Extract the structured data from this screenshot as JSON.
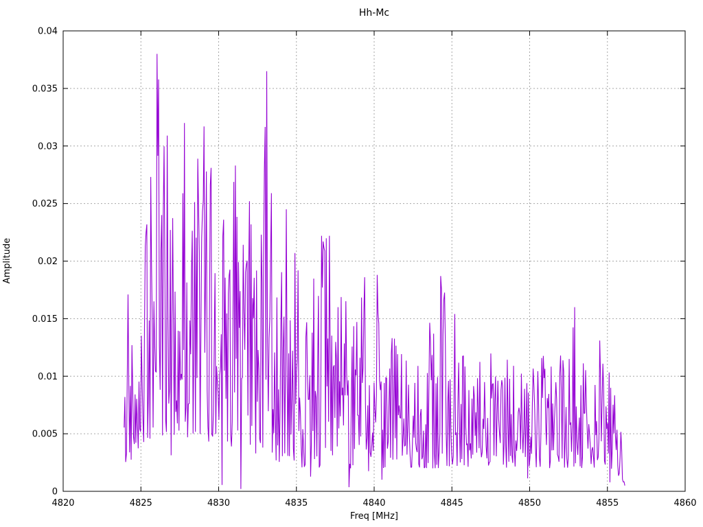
{
  "chart_data": {
    "type": "line",
    "title": "Hh-Mc",
    "xlabel": "Freq [MHz]",
    "ylabel": "Amplitude",
    "xlim": [
      4820,
      4860
    ],
    "ylim": [
      0,
      0.04
    ],
    "x_ticks": [
      4820,
      4825,
      4830,
      4835,
      4840,
      4845,
      4850,
      4855,
      4860
    ],
    "x_tick_labels": [
      "4820",
      "4825",
      "4830",
      "4835",
      "4840",
      "4845",
      "4850",
      "4855",
      "4860"
    ],
    "y_ticks": [
      0,
      0.005,
      0.01,
      0.015,
      0.02,
      0.025,
      0.03,
      0.035,
      0.04
    ],
    "y_tick_labels": [
      "0",
      "0.005",
      "0.01",
      "0.015",
      "0.02",
      "0.025",
      "0.03",
      "0.035",
      "0.04"
    ],
    "grid": true,
    "legend": "none",
    "line_color": "#9400d3",
    "grid_color": "#a6a6a6",
    "axis_color": "#000000",
    "background_color": "#ffffff",
    "data_start_freq": 4823.92,
    "data_end_freq": 4856.12,
    "n_points": 640,
    "noise_seed": 42,
    "envelope": {
      "freq": [
        4824.0,
        4824.5,
        4825.0,
        4825.5,
        4826.0,
        4826.5,
        4827.0,
        4827.5,
        4828.0,
        4828.5,
        4829.0,
        4829.5,
        4830.0,
        4830.5,
        4831.0,
        4831.5,
        4832.0,
        4832.5,
        4833.0,
        4833.5,
        4834.0,
        4834.5,
        4835.0,
        4835.5,
        4836.0,
        4836.5,
        4837.0,
        4837.5,
        4838.0,
        4838.5,
        4839.0,
        4839.5,
        4840.0,
        4840.5,
        4841.0,
        4841.5,
        4842.0,
        4842.5,
        4843.0,
        4843.5,
        4844.0,
        4844.5,
        4845.0,
        4845.5,
        4846.0,
        4846.5,
        4847.0,
        4847.5,
        4848.0,
        4848.5,
        4849.0,
        4849.5,
        4850.0,
        4850.5,
        4851.0,
        4851.5,
        4852.0,
        4852.5,
        4853.0,
        4853.5,
        4854.0,
        4854.5,
        4855.0,
        4855.5,
        4856.0
      ],
      "max": [
        0.01,
        0.017,
        0.019,
        0.027,
        0.038,
        0.031,
        0.027,
        0.029,
        0.032,
        0.029,
        0.032,
        0.028,
        0.024,
        0.024,
        0.028,
        0.022,
        0.025,
        0.022,
        0.0365,
        0.026,
        0.02,
        0.0245,
        0.02,
        0.019,
        0.021,
        0.0222,
        0.0222,
        0.02,
        0.016,
        0.019,
        0.018,
        0.0186,
        0.0188,
        0.018,
        0.014,
        0.0147,
        0.0135,
        0.0148,
        0.013,
        0.015,
        0.016,
        0.0187,
        0.0154,
        0.013,
        0.0132,
        0.012,
        0.0112,
        0.0125,
        0.011,
        0.0121,
        0.011,
        0.0123,
        0.0115,
        0.0108,
        0.0122,
        0.011,
        0.0135,
        0.013,
        0.016,
        0.012,
        0.011,
        0.0131,
        0.0108,
        0.009,
        0.0045
      ],
      "min": [
        0.002,
        0.003,
        0.004,
        0.004,
        0.005,
        0.004,
        0.003,
        0.004,
        0.003,
        0.004,
        0.005,
        0.004,
        0.003,
        0.004,
        0.003,
        0.002,
        0.003,
        0.003,
        0.004,
        0.003,
        0.002,
        0.003,
        0.002,
        0.002,
        0.003,
        0.002,
        0.003,
        0.002,
        0.002,
        0.002,
        0.003,
        0.002,
        0.001,
        0.002,
        0.002,
        0.002,
        0.002,
        0.002,
        0.002,
        0.002,
        0.002,
        0.002,
        0.002,
        0.002,
        0.002,
        0.002,
        0.0015,
        0.002,
        0.002,
        0.002,
        0.0015,
        0.002,
        0.002,
        0.002,
        0.002,
        0.002,
        0.002,
        0.002,
        0.002,
        0.002,
        0.002,
        0.002,
        0.002,
        0.0015,
        0.0008
      ]
    },
    "notable_points": [
      [
        4824.18,
        0.0171
      ],
      [
        4826.05,
        0.038
      ],
      [
        4826.7,
        0.0309
      ],
      [
        4827.78,
        0.032
      ],
      [
        4828.65,
        0.0289
      ],
      [
        4829.05,
        0.0317
      ],
      [
        4829.5,
        0.0281
      ],
      [
        4830.3,
        0.0236
      ],
      [
        4831.1,
        0.0283
      ],
      [
        4831.42,
        0.0002
      ],
      [
        4832.0,
        0.0252
      ],
      [
        4833.08,
        0.0365
      ],
      [
        4833.4,
        0.0259
      ],
      [
        4834.35,
        0.0245
      ],
      [
        4836.6,
        0.0222
      ],
      [
        4837.1,
        0.0222
      ],
      [
        4839.4,
        0.0186
      ],
      [
        4840.2,
        0.0188
      ],
      [
        4844.3,
        0.0187
      ],
      [
        4845.2,
        0.0154
      ],
      [
        4852.9,
        0.016
      ],
      [
        4854.5,
        0.0131
      ],
      [
        4856.1,
        0.0005
      ]
    ]
  }
}
